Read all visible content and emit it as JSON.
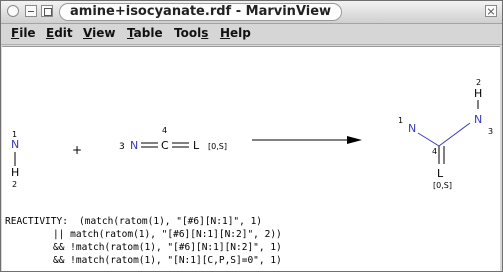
{
  "window": {
    "title": "amine+isocyanate.rdf - MarvinView"
  },
  "menu": [
    {
      "label": "File",
      "underline_index": 0
    },
    {
      "label": "Edit",
      "underline_index": 0
    },
    {
      "label": "View",
      "underline_index": 0
    },
    {
      "label": "Table",
      "underline_index": 0
    },
    {
      "label": "Tools",
      "underline_index": 4
    },
    {
      "label": "Help",
      "underline_index": 0
    }
  ],
  "reaction": {
    "reactant1": {
      "map1": "1",
      "atom1": "N",
      "atom2": "H",
      "map2": "2"
    },
    "plus": "+",
    "reactant2": {
      "map3": "3",
      "atomN": "N",
      "atomC": "C",
      "map4": "4",
      "atomL": "L",
      "list": "[0,S]"
    },
    "product": {
      "map2": "2",
      "atomH": "H",
      "map1": "1",
      "atomN1": "N",
      "atomN3": "N",
      "map3": "3",
      "map4": "4",
      "atomL": "L",
      "list": "[0,S]"
    },
    "colors": {
      "nitrogen": "#3a3ab8",
      "bond": "#000000"
    }
  },
  "reactivity": {
    "label": "REACTIVITY:",
    "lines": [
      "(match(ratom(1), \"[#6][N:1]\", 1)",
      "|| match(ratom(1), \"[#6][N:1][N:2]\", 2))",
      "&& !match(ratom(1), \"[#6][N:1][N:2]\", 1)",
      "&& !match(ratom(1), \"[N:1][C,P,S]=0\", 1)"
    ]
  }
}
